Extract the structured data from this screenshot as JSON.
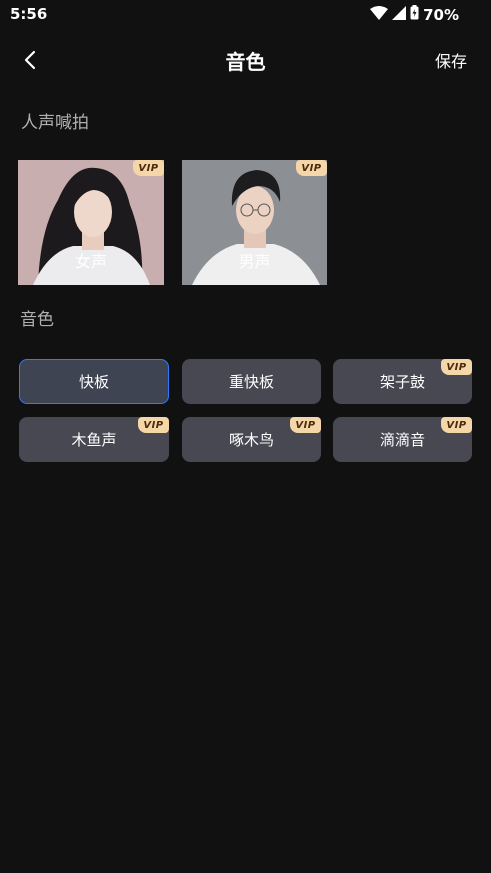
{
  "status": {
    "time": "5:56",
    "battery": "70%"
  },
  "nav": {
    "title": "音色",
    "save_label": "保存"
  },
  "sections": {
    "vocal_title": "人声喊拍",
    "tone_title": "音色"
  },
  "voices": [
    {
      "label": "女声",
      "vip": "VIP"
    },
    {
      "label": "男声",
      "vip": "VIP"
    }
  ],
  "tones": [
    {
      "label": "快板",
      "vip": ""
    },
    {
      "label": "重快板",
      "vip": ""
    },
    {
      "label": "架子鼓",
      "vip": "VIP"
    },
    {
      "label": "木鱼声",
      "vip": "VIP"
    },
    {
      "label": "啄木鸟",
      "vip": "VIP"
    },
    {
      "label": "滴滴音",
      "vip": "VIP"
    }
  ],
  "colors": {
    "background": "#111111",
    "button": "#474852",
    "selected_border": "#2f7bff",
    "vip_badge": "#f5d6a8"
  }
}
